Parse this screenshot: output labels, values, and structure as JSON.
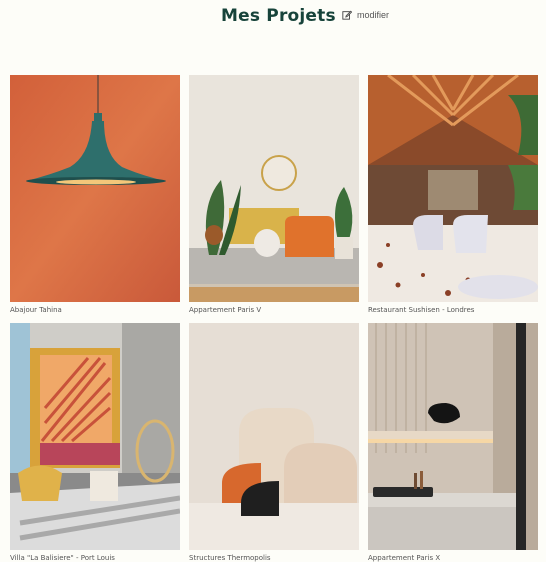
{
  "header": {
    "title": "Mes Projets",
    "edit_label": "modifier",
    "edit_icon": "edit-icon"
  },
  "projects": [
    {
      "caption": "Abajour Tahina"
    },
    {
      "caption": "Appartement Paris V"
    },
    {
      "caption": "Restaurant Sushisen - Londres"
    },
    {
      "caption": "Villa \"La Balisiere\" - Port Louis"
    },
    {
      "caption": "Structures Thermopolis"
    },
    {
      "caption": "Appartement Paris X"
    }
  ]
}
